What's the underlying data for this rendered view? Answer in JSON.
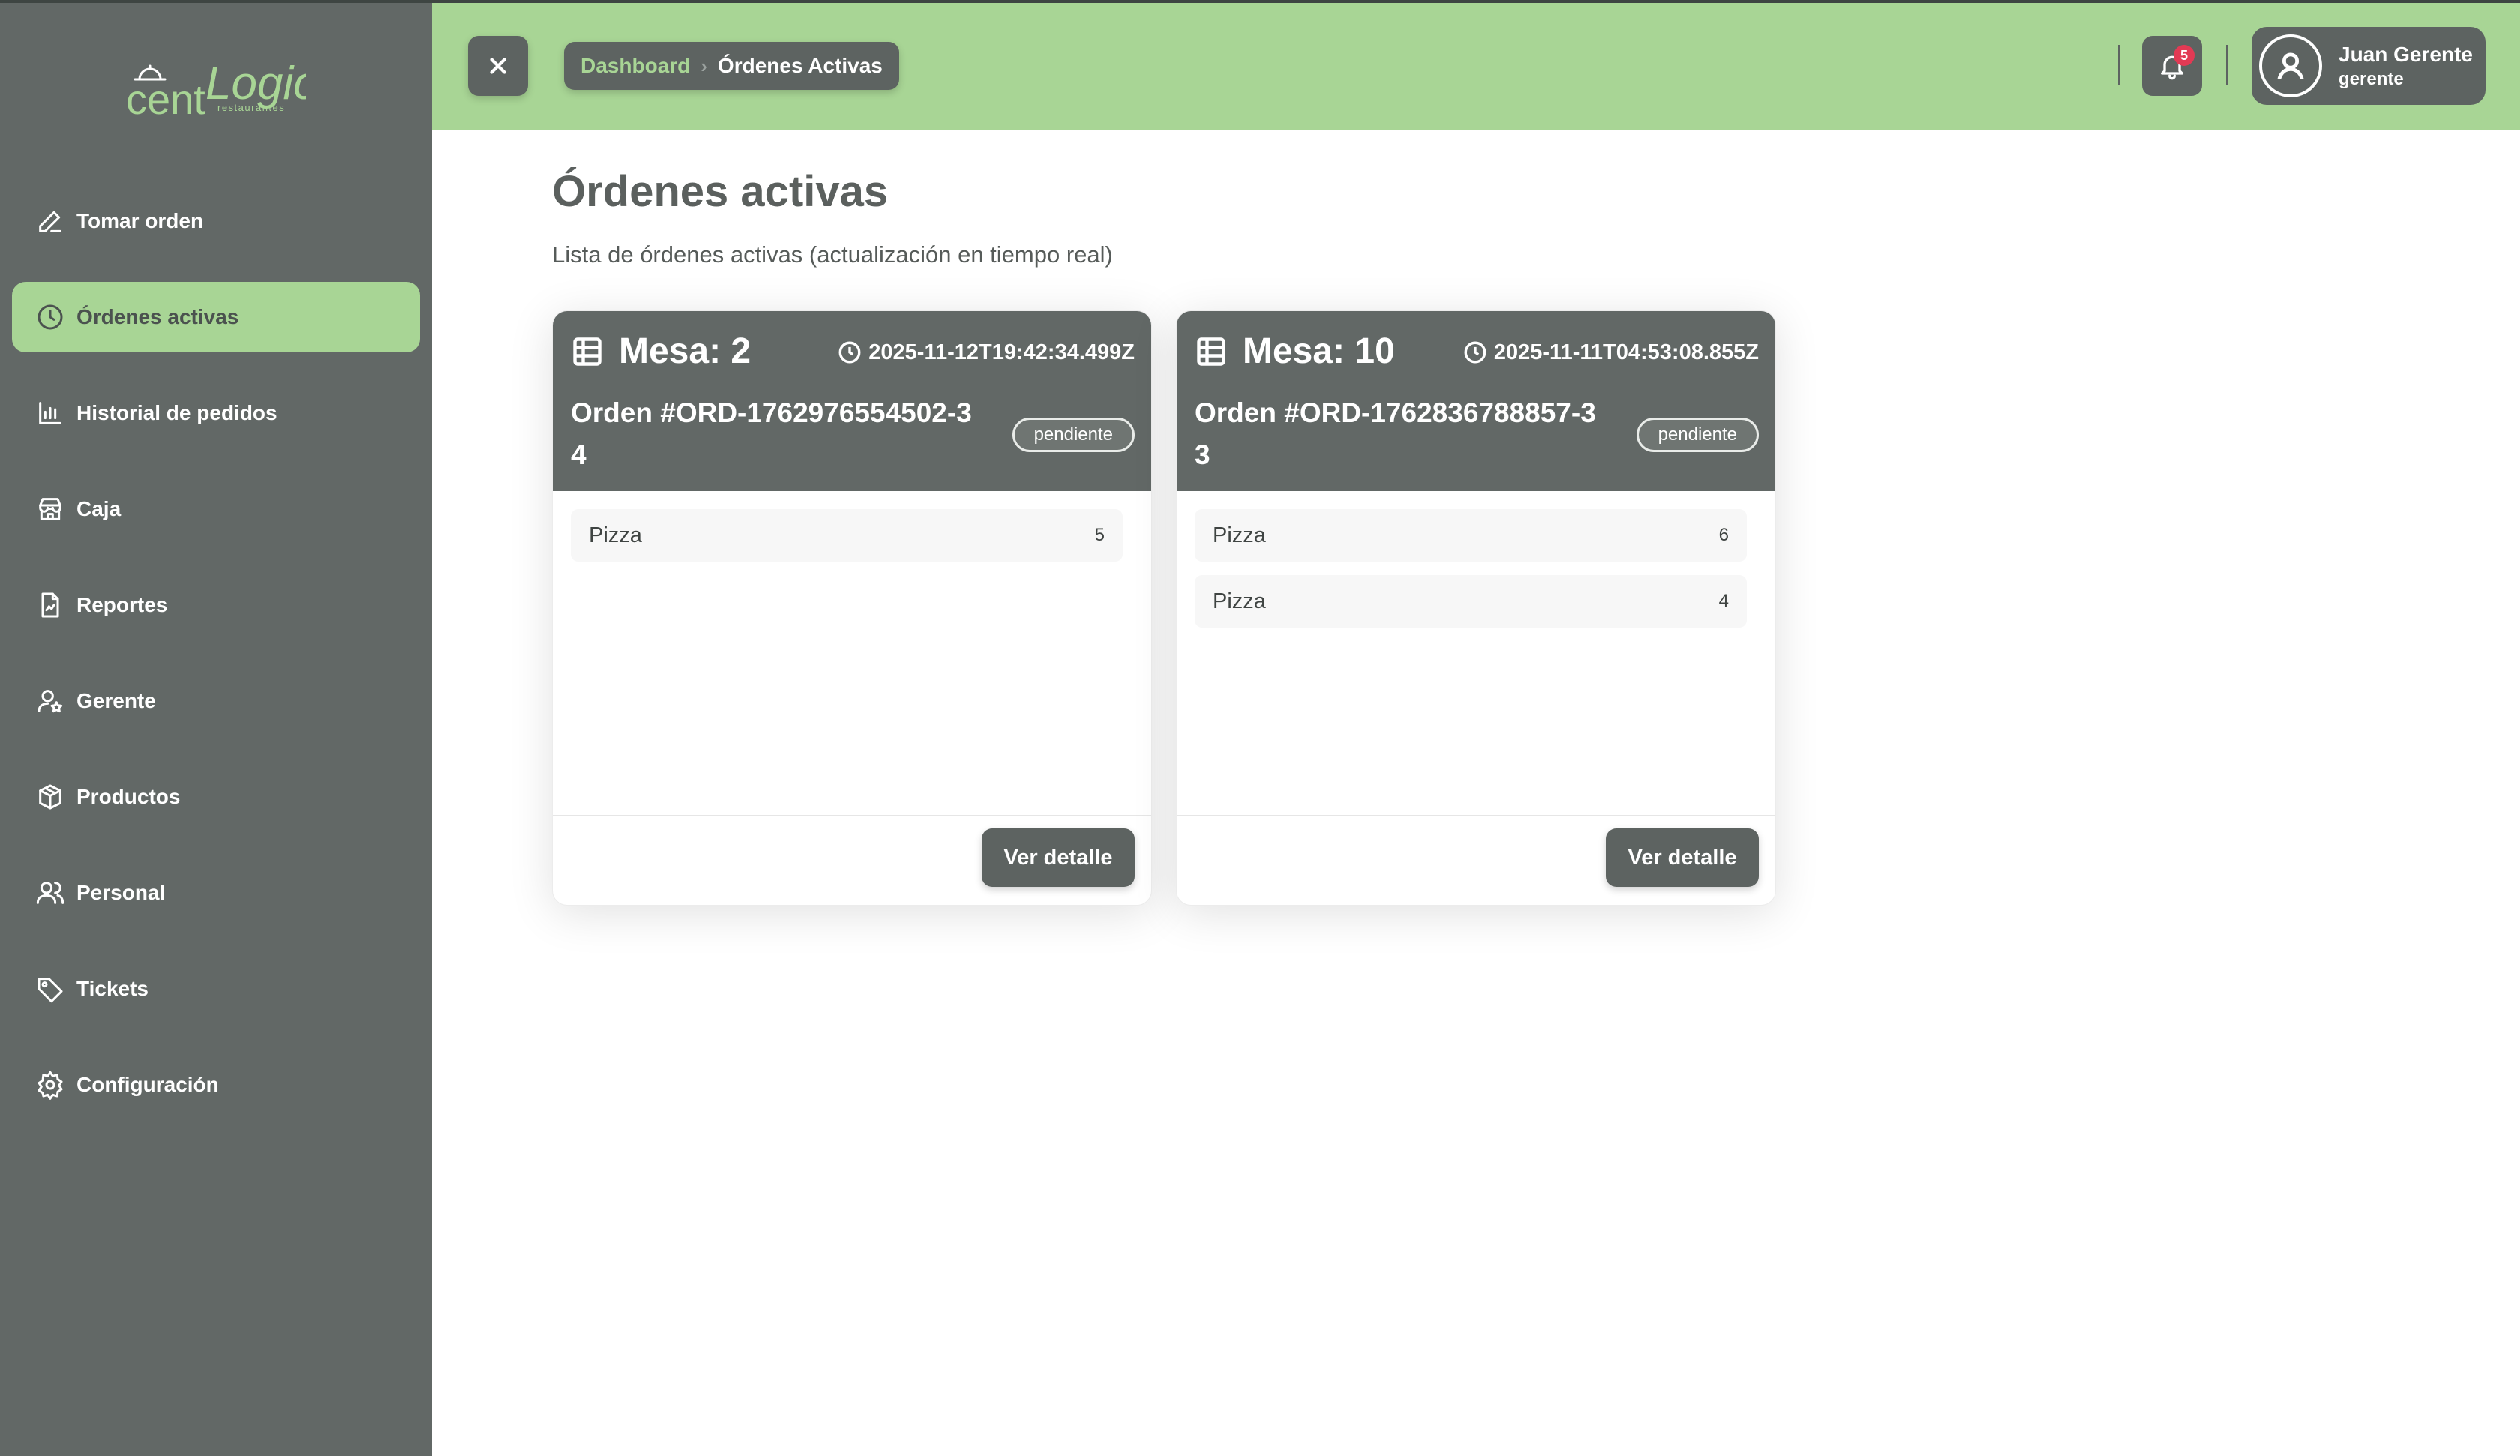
{
  "brand": {
    "logo_word_1": "cent",
    "logo_word_2": "Logic",
    "logo_tagline": "restaurantes"
  },
  "sidebar": {
    "items": [
      {
        "label": "Tomar orden",
        "icon": "pencil-icon"
      },
      {
        "label": "Órdenes activas",
        "icon": "clock-icon",
        "active": true
      },
      {
        "label": "Historial de pedidos",
        "icon": "bar-chart-icon"
      },
      {
        "label": "Caja",
        "icon": "store-icon"
      },
      {
        "label": "Reportes",
        "icon": "file-chart-icon"
      },
      {
        "label": "Gerente",
        "icon": "user-star-icon"
      },
      {
        "label": "Productos",
        "icon": "package-icon"
      },
      {
        "label": "Personal",
        "icon": "users-icon"
      },
      {
        "label": "Tickets",
        "icon": "tag-icon"
      },
      {
        "label": "Configuración",
        "icon": "gear-icon"
      }
    ]
  },
  "header": {
    "breadcrumb": {
      "parent": "Dashboard",
      "current": "Órdenes Activas"
    },
    "notifications": {
      "count": "5"
    },
    "user": {
      "name": "Juan Gerente",
      "role": "gerente"
    }
  },
  "main": {
    "title": "Órdenes activas",
    "subtitle": "Lista de órdenes activas (actualización en tiempo real)",
    "orders": [
      {
        "mesa": "Mesa: 2",
        "timestamp": "2025-11-12T19:42:34.499Z",
        "order_id": "Orden #ORD-1762976554502-34",
        "status": "pendiente",
        "items": [
          {
            "name": "Pizza",
            "qty": "5"
          }
        ],
        "button": "Ver detalle"
      },
      {
        "mesa": "Mesa: 10",
        "timestamp": "2025-11-11T04:53:08.855Z",
        "order_id": "Orden #ORD-1762836788857-33",
        "status": "pendiente",
        "items": [
          {
            "name": "Pizza",
            "qty": "6"
          },
          {
            "name": "Pizza",
            "qty": "4"
          }
        ],
        "button": "Ver detalle"
      }
    ]
  },
  "colors": {
    "accent": "#a8d595",
    "sidebar": "#626866",
    "badge": "#e23a54"
  }
}
